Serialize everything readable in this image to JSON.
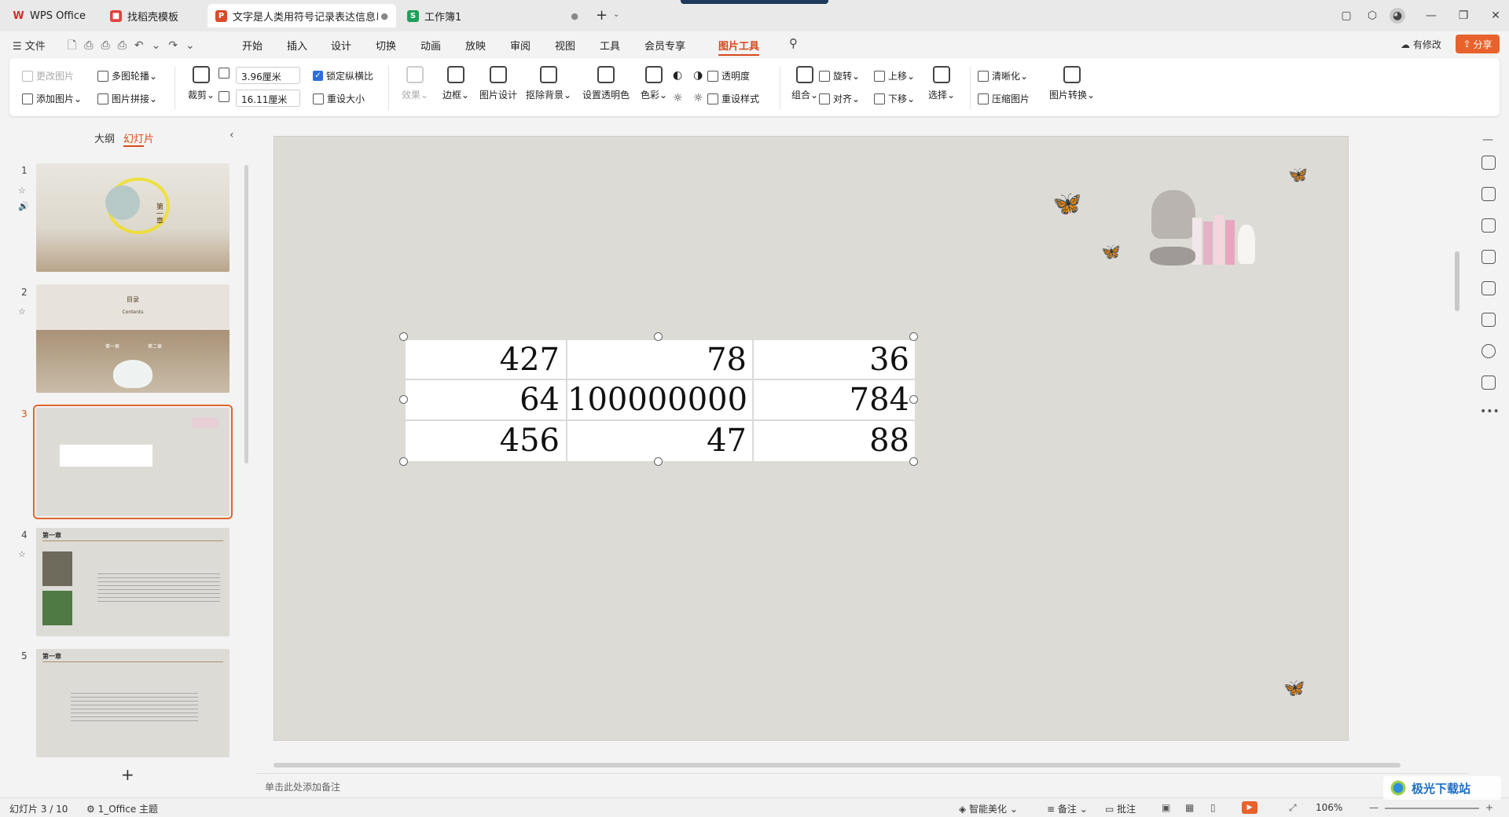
{
  "tabs": [
    {
      "label": "WPS Office"
    },
    {
      "label": "找稻壳模板"
    },
    {
      "label": "文字是人类用符号记录表达信息以"
    },
    {
      "label": "工作簿1"
    }
  ],
  "file_menu": "文件",
  "menus": [
    "开始",
    "插入",
    "设计",
    "切换",
    "动画",
    "放映",
    "审阅",
    "视图",
    "工具",
    "会员专享",
    "图片工具"
  ],
  "active_menu": "图片工具",
  "modify_label": "有修改",
  "share_label": "分享",
  "ribbon": {
    "change_picture": "更改图片",
    "multi_carousel": "多图轮播",
    "add_picture": "添加图片",
    "picture_collage": "图片拼接",
    "crop": "裁剪",
    "width": "3.96厘米",
    "height": "16.11厘米",
    "lock_ratio": "锁定纵横比",
    "reset_size": "重设大小",
    "effects": "效果",
    "border": "边框",
    "picture_design": "图片设计",
    "remove_bg": "抠除背景",
    "set_transparent": "设置透明色",
    "color": "色彩",
    "transparency": "透明度",
    "reset_style": "重设样式",
    "group": "组合",
    "rotate": "旋转",
    "align": "对齐",
    "bring_forward": "上移",
    "send_backward": "下移",
    "select": "选择",
    "sharpen": "清晰化",
    "compress": "压缩图片",
    "convert": "图片转换"
  },
  "panel": {
    "outline_tab": "大纲",
    "slides_tab": "幻灯片"
  },
  "thumbs": [
    {
      "num": "1",
      "title": "第一章"
    },
    {
      "num": "2",
      "title": "目录",
      "subtitle": "Contents",
      "items": [
        "第一章",
        "第二章"
      ]
    },
    {
      "num": "3"
    },
    {
      "num": "4",
      "title": "第一章"
    },
    {
      "num": "5",
      "title": "第一章"
    }
  ],
  "table": [
    [
      "427",
      "78",
      "36"
    ],
    [
      "64",
      "100000000",
      "784"
    ],
    [
      "456",
      "47",
      "88"
    ]
  ],
  "notes_placeholder": "单击此处添加备注",
  "status": {
    "slide_info": "幻灯片 3 / 10",
    "theme": "1_Office 主题",
    "smart_beautify": "智能美化",
    "notes": "备注",
    "comments": "批注",
    "zoom": "106%"
  },
  "watermark": "极光下载站"
}
